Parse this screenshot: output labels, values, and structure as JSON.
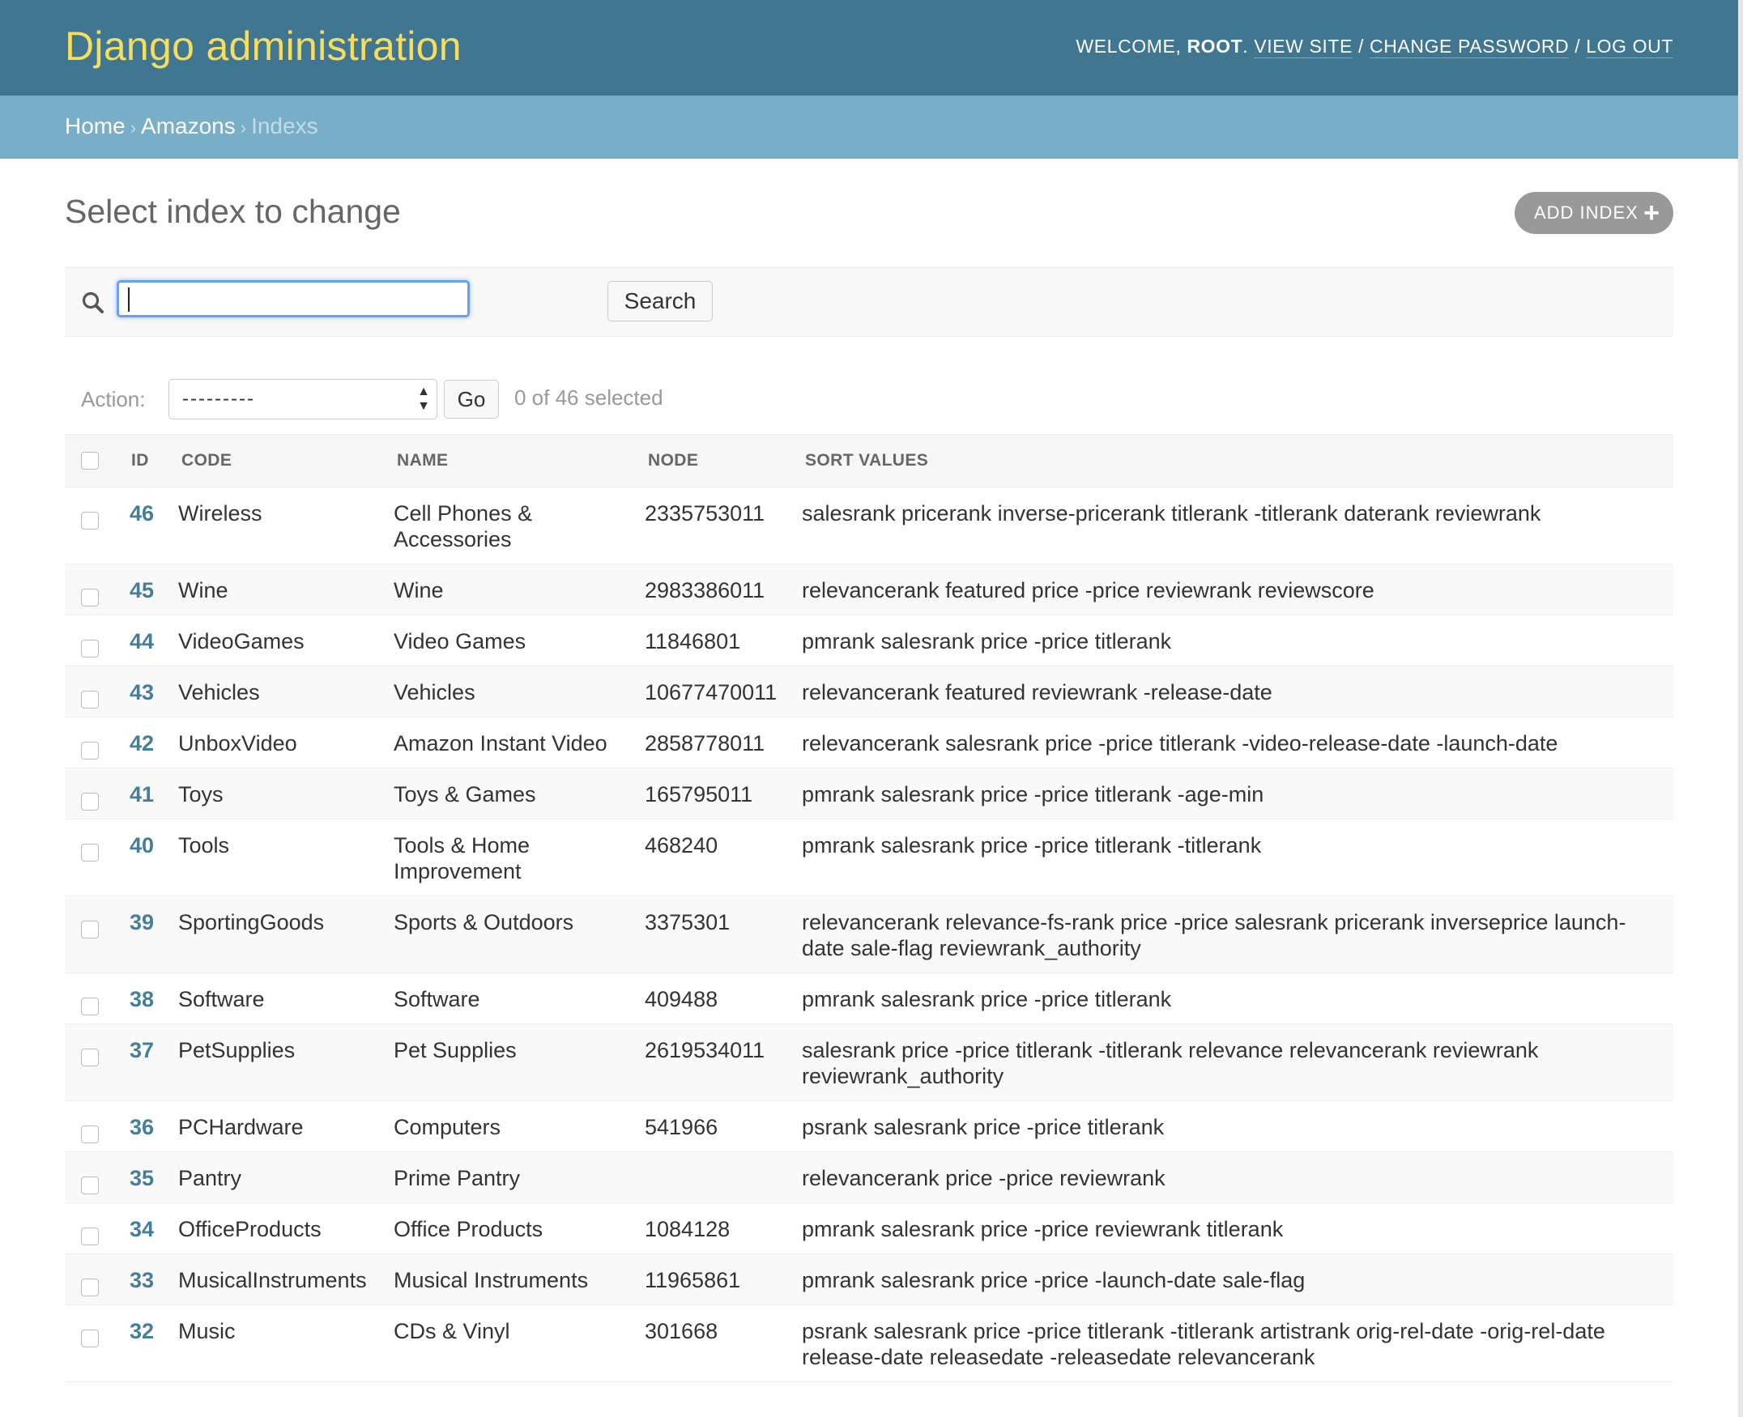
{
  "header": {
    "site_name": "Django administration",
    "welcome": "Welcome,",
    "username": "root",
    "view_site": "View site",
    "change_password": "Change password",
    "log_out": "Log out",
    "separator": "/"
  },
  "breadcrumbs": {
    "home": "Home",
    "app": "Amazons",
    "current": "Indexs",
    "separator": "›"
  },
  "page": {
    "title": "Select index to change",
    "add_button": "Add index",
    "add_icon": "plus-icon"
  },
  "search": {
    "icon": "search-icon",
    "value": "",
    "button": "Search"
  },
  "actions": {
    "label": "Action:",
    "selected_option": "---------",
    "go": "Go",
    "selected_count": "0 of 46 selected"
  },
  "table": {
    "columns": [
      "ID",
      "Code",
      "Name",
      "Node",
      "Sort values"
    ],
    "rows": [
      {
        "id": "46",
        "code": "Wireless",
        "name": "Cell Phones & Accessories",
        "node": "2335753011",
        "sort_values": "salesrank pricerank inverse-pricerank titlerank -titlerank daterank reviewrank"
      },
      {
        "id": "45",
        "code": "Wine",
        "name": "Wine",
        "node": "2983386011",
        "sort_values": "relevancerank featured price -price reviewrank reviewscore"
      },
      {
        "id": "44",
        "code": "VideoGames",
        "name": "Video Games",
        "node": "11846801",
        "sort_values": "pmrank salesrank price -price titlerank"
      },
      {
        "id": "43",
        "code": "Vehicles",
        "name": "Vehicles",
        "node": "10677470011",
        "sort_values": "relevancerank featured reviewrank -release-date"
      },
      {
        "id": "42",
        "code": "UnboxVideo",
        "name": "Amazon Instant Video",
        "node": "2858778011",
        "sort_values": "relevancerank salesrank price -price titlerank -video-release-date -launch-date"
      },
      {
        "id": "41",
        "code": "Toys",
        "name": "Toys & Games",
        "node": "165795011",
        "sort_values": "pmrank salesrank price -price titlerank -age-min"
      },
      {
        "id": "40",
        "code": "Tools",
        "name": "Tools & Home Improvement",
        "node": "468240",
        "sort_values": "pmrank salesrank price -price titlerank -titlerank"
      },
      {
        "id": "39",
        "code": "SportingGoods",
        "name": "Sports & Outdoors",
        "node": "3375301",
        "sort_values": "relevancerank relevance-fs-rank price -price salesrank pricerank inverseprice launch-date sale-flag reviewrank_authority"
      },
      {
        "id": "38",
        "code": "Software",
        "name": "Software",
        "node": "409488",
        "sort_values": "pmrank salesrank price -price titlerank"
      },
      {
        "id": "37",
        "code": "PetSupplies",
        "name": "Pet Supplies",
        "node": "2619534011",
        "sort_values": "salesrank price -price titlerank -titlerank relevance relevancerank reviewrank reviewrank_authority"
      },
      {
        "id": "36",
        "code": "PCHardware",
        "name": "Computers",
        "node": "541966",
        "sort_values": "psrank salesrank price -price titlerank"
      },
      {
        "id": "35",
        "code": "Pantry",
        "name": "Prime Pantry",
        "node": "",
        "sort_values": "relevancerank price -price reviewrank"
      },
      {
        "id": "34",
        "code": "OfficeProducts",
        "name": "Office Products",
        "node": "1084128",
        "sort_values": "pmrank salesrank price -price reviewrank titlerank"
      },
      {
        "id": "33",
        "code": "MusicalInstruments",
        "name": "Musical Instruments",
        "node": "11965861",
        "sort_values": "pmrank salesrank price -price -launch-date sale-flag"
      },
      {
        "id": "32",
        "code": "Music",
        "name": "CDs & Vinyl",
        "node": "301668",
        "sort_values": "psrank salesrank price -price titlerank -titlerank artistrank orig-rel-date -orig-rel-date release-date releasedate -releasedate relevancerank"
      }
    ]
  },
  "colors": {
    "header_bg": "#417690",
    "branding": "#f5dd5d",
    "breadcrumbs_bg": "#79aec8",
    "link": "#447e9b",
    "add_button_bg": "#999999",
    "search_focus": "#69a1f0"
  }
}
